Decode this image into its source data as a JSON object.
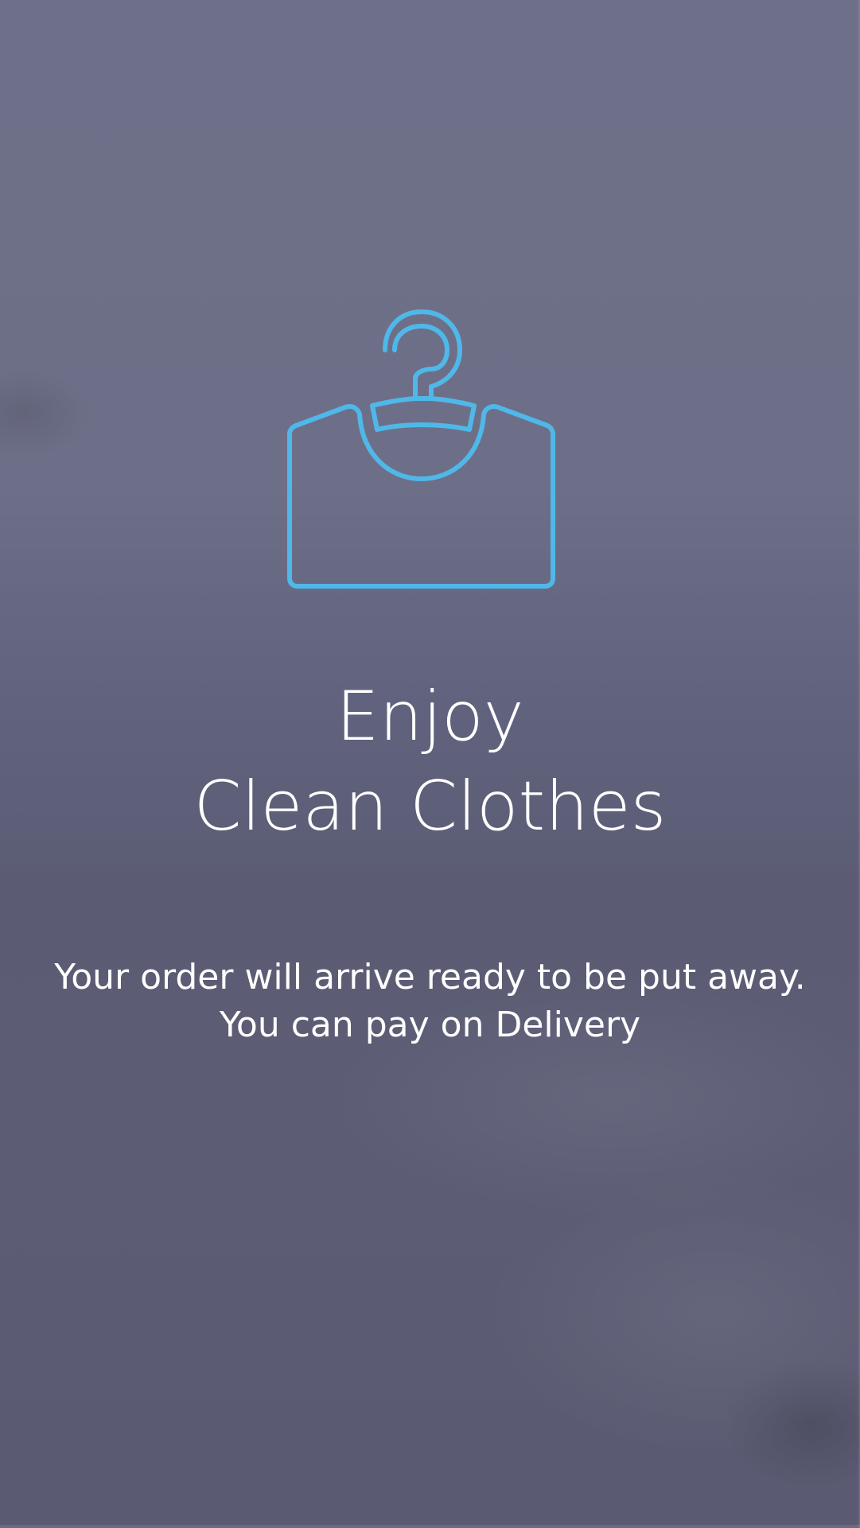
{
  "screen": {
    "background_color": "#5f617a",
    "icon": {
      "name": "clothes-hanger-icon",
      "color": "#4fb8e8"
    },
    "title_lines": [
      "Enjoy",
      "Clean Clothes"
    ],
    "subtitle_lines": [
      "Your order will arrive ready to be put away.",
      "You can pay on Delivery"
    ]
  }
}
